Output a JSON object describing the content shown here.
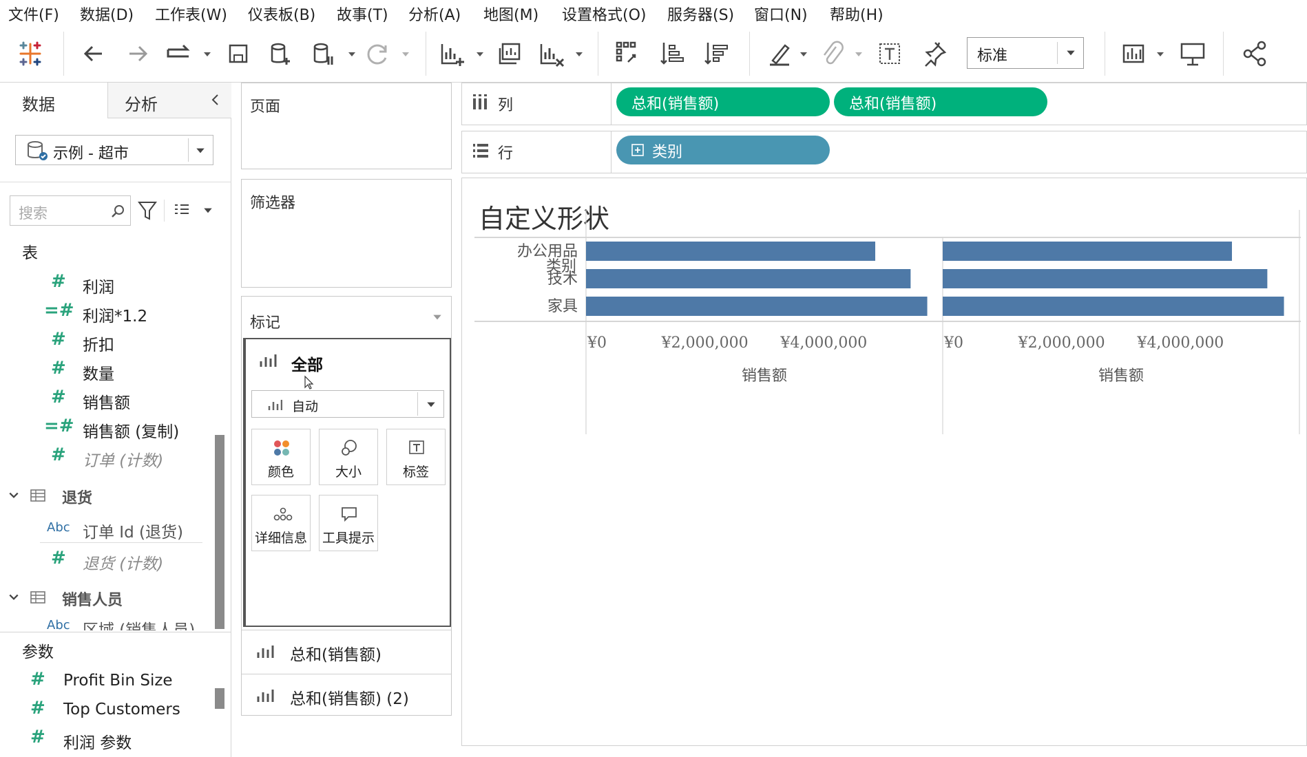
{
  "menu": [
    "文件(F)",
    "数据(D)",
    "工作表(W)",
    "仪表板(B)",
    "故事(T)",
    "分析(A)",
    "地图(M)",
    "设置格式(O)",
    "服务器(S)",
    "窗口(N)",
    "帮助(H)"
  ],
  "toolbar": {
    "fit_select": "标准"
  },
  "left": {
    "tab_data": "数据",
    "tab_analysis": "分析",
    "datasource": "示例 - 超市",
    "search_placeholder": "搜索",
    "tables_header": "表",
    "fields": [
      {
        "type": "measure",
        "name": "利润",
        "italic": false
      },
      {
        "type": "calc",
        "name": "利润*1.2",
        "italic": false
      },
      {
        "type": "measure",
        "name": "折扣",
        "italic": false
      },
      {
        "type": "measure",
        "name": "数量",
        "italic": false
      },
      {
        "type": "measure",
        "name": "销售额",
        "italic": false
      },
      {
        "type": "calc",
        "name": "销售额 (复制)",
        "italic": false
      },
      {
        "type": "measure",
        "name": "订单 (计数)",
        "italic": true
      }
    ],
    "table_returns": "退货",
    "returns_fields": [
      {
        "type": "dim",
        "name": "订单 Id (退货)",
        "italic": false
      },
      {
        "type": "measure",
        "name": "退货 (计数)",
        "italic": true
      }
    ],
    "table_sales": "销售人员",
    "sales_fields": [
      {
        "type": "dim",
        "name": "区域 (销售人员)",
        "italic": false
      }
    ],
    "params_header": "参数",
    "params": [
      "Profit Bin Size",
      "Top Customers",
      "利润 参数"
    ]
  },
  "cards": {
    "pages": "页面",
    "filters": "筛选器",
    "marks": "标记",
    "marks_all": "全部",
    "marks_type": "自动",
    "buttons": [
      "颜色",
      "大小",
      "标签",
      "详细信息",
      "工具提示"
    ],
    "measures": [
      "总和(销售额)",
      "总和(销售额) (2)"
    ]
  },
  "shelves": {
    "columns_label": "列",
    "rows_label": "行",
    "column_pills": [
      "总和(销售额)",
      "总和(销售额)"
    ],
    "row_pills": [
      "类别"
    ]
  },
  "viz": {
    "title": "自定义形状",
    "header": "类别",
    "ticks": [
      "¥0",
      "¥2,000,000",
      "¥4,000,000"
    ],
    "axis_label": "销售额",
    "bar_color": "#4e79a7"
  },
  "chart_data": {
    "type": "bar",
    "orientation": "horizontal",
    "title": "自定义形状",
    "categories": [
      "办公用品",
      "技术",
      "家具"
    ],
    "series": [
      {
        "name": "总和(销售额)",
        "values": [
          4865000,
          5460000,
          5740000
        ]
      },
      {
        "name": "总和(销售额)",
        "values": [
          4865000,
          5460000,
          5740000
        ]
      }
    ],
    "xlabel": "销售额",
    "ylabel": "类别",
    "xlim": [
      0,
      6000000
    ],
    "grid": false
  }
}
